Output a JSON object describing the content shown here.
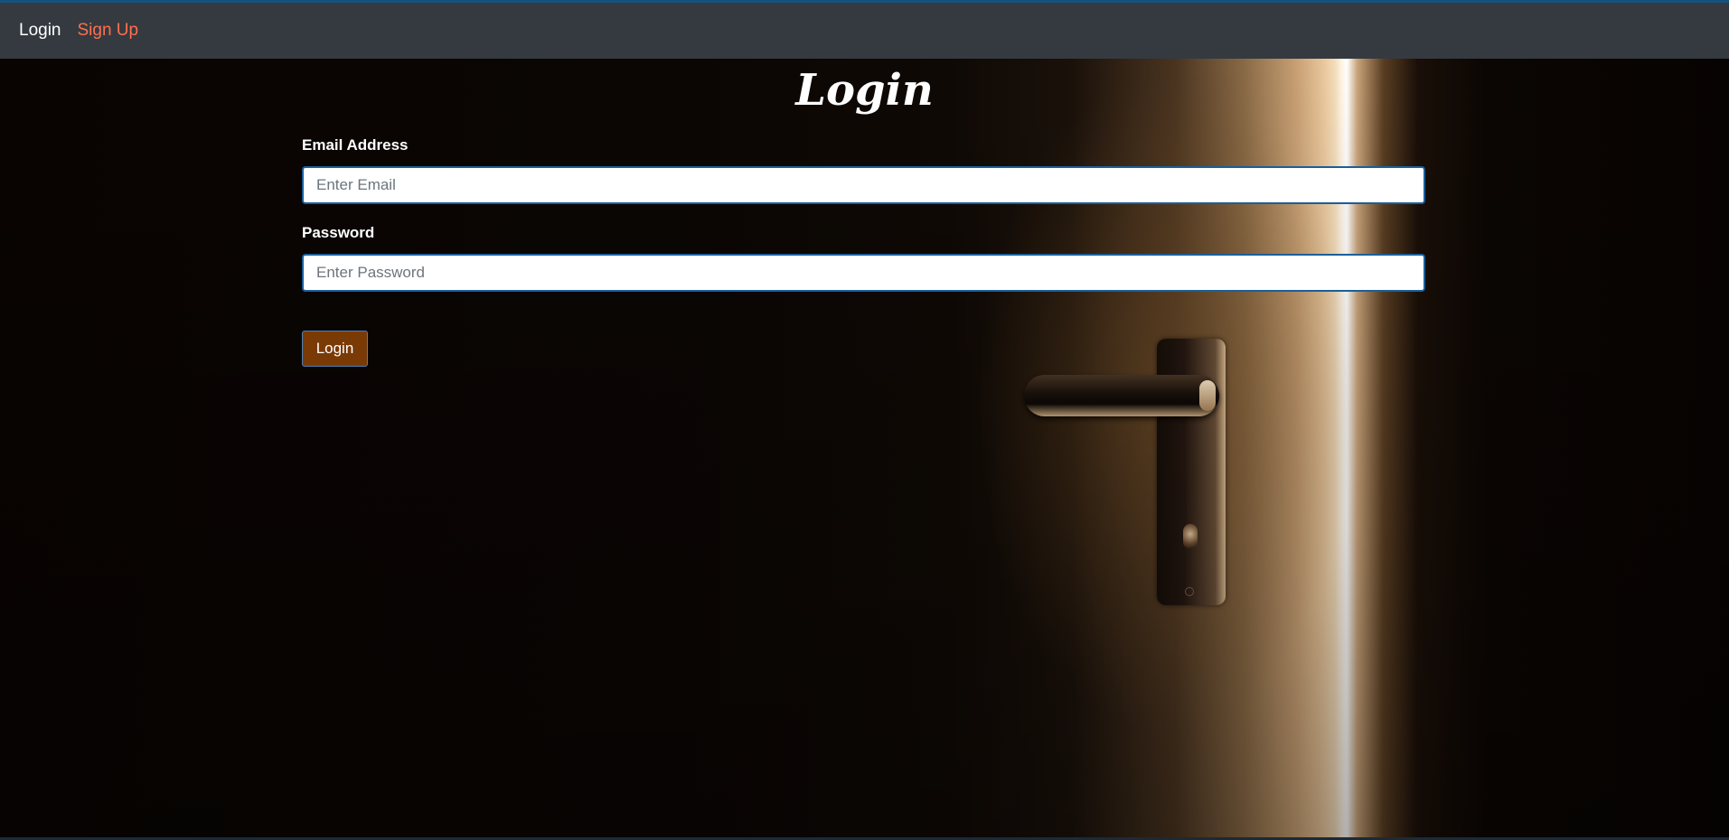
{
  "nav": {
    "login_label": "Login",
    "signup_label": "Sign Up"
  },
  "form": {
    "title": "Login",
    "email_label": "Email Address",
    "email_placeholder": "Enter Email",
    "email_value": "",
    "password_label": "Password",
    "password_placeholder": "Enter Password",
    "password_value": "",
    "submit_label": "Login"
  },
  "colors": {
    "navbar_bg": "#343a40",
    "nav_active": "#ffffff",
    "nav_link": "#ff6f4e",
    "button_bg": "#7a3a06",
    "input_border": "#1b5f9a"
  },
  "background": {
    "image": "door-slightly-open-with-light"
  }
}
